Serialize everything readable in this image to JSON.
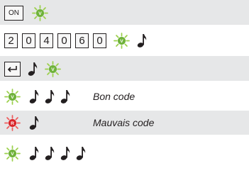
{
  "keys": {
    "on": "ON",
    "code_digits": [
      "2",
      "0",
      "4",
      "0",
      "6",
      "0"
    ]
  },
  "messages": {
    "good": "Bon code",
    "bad": "Mauvais code"
  },
  "leds": {
    "green_letter": "V",
    "red_letter": "R",
    "green_color": "#9bd04a",
    "green_inner": "#6fb23a",
    "red_color": "#ef5b5b",
    "red_inner": "#d9252a"
  },
  "icons": {
    "note": "eighth-note-icon",
    "enter": "enter-key-icon"
  },
  "band_color": "#e6e7e8"
}
